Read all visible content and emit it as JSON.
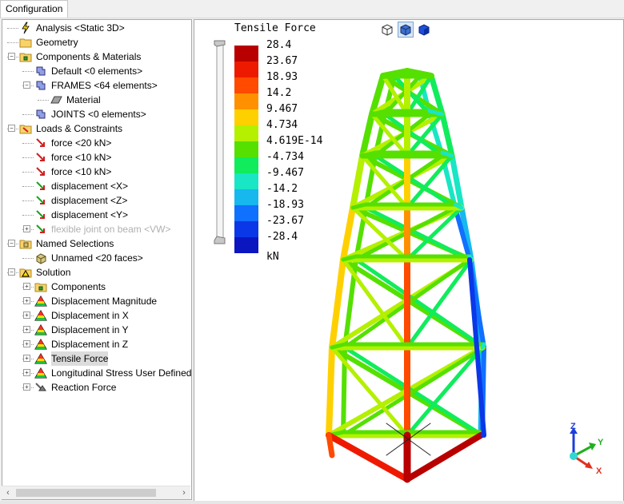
{
  "tabs": [
    "Configuration"
  ],
  "tree": [
    {
      "label": "Analysis <Static 3D>",
      "icon": "analysis-icon",
      "level": 0,
      "expander": "none"
    },
    {
      "label": "Geometry",
      "icon": "folder-icon",
      "level": 0,
      "expander": "none"
    },
    {
      "label": "Components & Materials",
      "icon": "components-icon",
      "level": 0,
      "expander": "minus"
    },
    {
      "label": "Default <0 elements>",
      "icon": "component-icon",
      "level": 1,
      "expander": "none"
    },
    {
      "label": "FRAMES <64 elements>",
      "icon": "component-icon",
      "level": 1,
      "expander": "minus"
    },
    {
      "label": "Material",
      "icon": "material-icon",
      "level": 2,
      "expander": "none"
    },
    {
      "label": "JOINTS <0 elements>",
      "icon": "component-icon",
      "level": 1,
      "expander": "none"
    },
    {
      "label": "Loads & Constraints",
      "icon": "loads-folder-icon",
      "level": 0,
      "expander": "minus"
    },
    {
      "label": "force <20 kN>",
      "icon": "force-icon",
      "level": 1,
      "expander": "none"
    },
    {
      "label": "force <10 kN>",
      "icon": "force-icon",
      "level": 1,
      "expander": "none"
    },
    {
      "label": "force <10 kN>",
      "icon": "force-icon",
      "level": 1,
      "expander": "none"
    },
    {
      "label": "displacement <X>",
      "icon": "displacement-icon",
      "level": 1,
      "expander": "none"
    },
    {
      "label": "displacement <Z>",
      "icon": "displacement-icon",
      "level": 1,
      "expander": "none"
    },
    {
      "label": "displacement <Y>",
      "icon": "displacement-icon",
      "level": 1,
      "expander": "none"
    },
    {
      "label": "flexible joint on beam <VW>",
      "icon": "flexible-joint-icon",
      "level": 1,
      "expander": "plus",
      "grey": true
    },
    {
      "label": "Named Selections",
      "icon": "named-selections-icon",
      "level": 0,
      "expander": "minus"
    },
    {
      "label": "Unnamed <20 faces>",
      "icon": "faces-icon",
      "level": 1,
      "expander": "none"
    },
    {
      "label": "Solution",
      "icon": "solution-icon",
      "level": 0,
      "expander": "minus"
    },
    {
      "label": "Components",
      "icon": "components-icon",
      "level": 1,
      "expander": "plus"
    },
    {
      "label": "Displacement Magnitude",
      "icon": "result-icon",
      "level": 1,
      "expander": "plus"
    },
    {
      "label": "Displacement in X",
      "icon": "result-icon",
      "level": 1,
      "expander": "plus"
    },
    {
      "label": "Displacement in Y",
      "icon": "result-icon",
      "level": 1,
      "expander": "plus"
    },
    {
      "label": "Displacement in Z",
      "icon": "result-icon",
      "level": 1,
      "expander": "plus"
    },
    {
      "label": "Tensile Force",
      "icon": "result-icon",
      "level": 1,
      "expander": "plus",
      "selected": true
    },
    {
      "label": "Longitudinal Stress User Defined",
      "icon": "result-icon",
      "level": 1,
      "expander": "plus"
    },
    {
      "label": "Reaction Force",
      "icon": "reaction-icon",
      "level": 1,
      "expander": "plus"
    }
  ],
  "legend": {
    "title": "Tensile Force",
    "values": [
      "28.4",
      "23.67",
      "18.93",
      "14.2",
      "9.467",
      "4.734",
      "4.619E-14",
      "-4.734",
      "-9.467",
      "-14.2",
      "-18.93",
      "-23.67",
      "-28.4"
    ],
    "colors": [
      "#b80000",
      "#ee1a00",
      "#ff4a00",
      "#ff9100",
      "#ffd000",
      "#b4f000",
      "#55e000",
      "#10ec5c",
      "#18e6c4",
      "#16b8ee",
      "#1070ff",
      "#0a38e8",
      "#0c16c0"
    ],
    "unit": "kN"
  },
  "view_buttons": [
    "wireframe-view-icon",
    "solid-view-icon",
    "shaded-view-icon"
  ],
  "axes": {
    "x": "X",
    "y": "Y",
    "z": "Z"
  }
}
